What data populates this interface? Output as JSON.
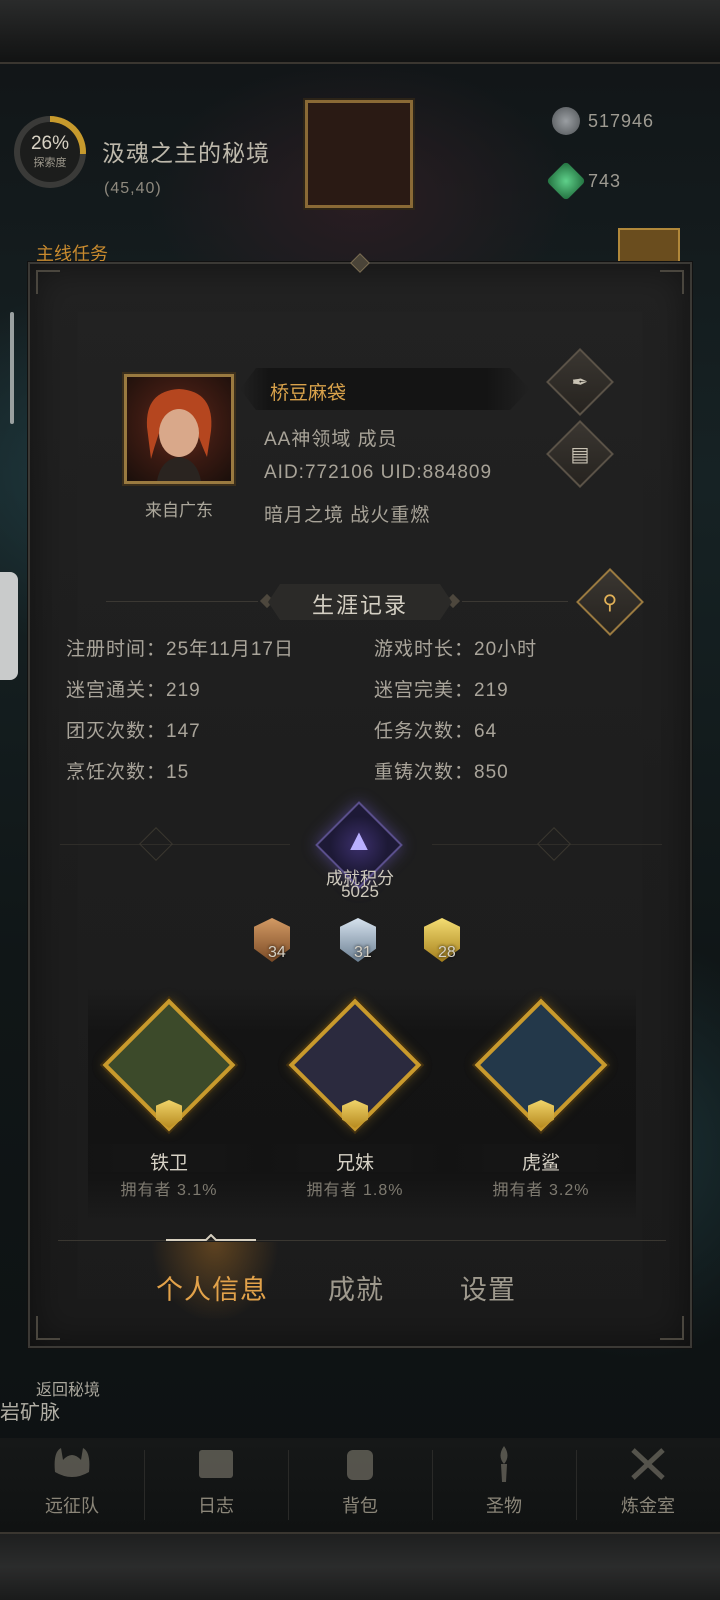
{
  "hud": {
    "explore_percent": "26%",
    "explore_label": "探索度",
    "realm_title": "汲魂之主的秘境",
    "realm_coord": "(45,40)",
    "silver_amount": "517946",
    "gem_amount": "743",
    "task_label": "主线任务",
    "back_label": "返回秘境",
    "area_label": "岩矿脉"
  },
  "profile": {
    "name": "桥豆麻袋",
    "guild": "AA神领域  成员",
    "ids": "AID:772106 UID:884809",
    "server": "暗月之境  战火重燃",
    "origin": "来自广东",
    "edit_icon": "quill-icon",
    "copy_icon": "document-icon"
  },
  "career": {
    "title": "生涯记录",
    "search_icon": "magnifier-icon",
    "stats": [
      {
        "label": "注册时间：25年11月17日"
      },
      {
        "label": "游戏时长：20小时"
      },
      {
        "label": "迷宫通关：219"
      },
      {
        "label": "迷宫完美：219"
      },
      {
        "label": "团灭次数：147"
      },
      {
        "label": "任务次数：64"
      },
      {
        "label": "烹饪次数：15"
      },
      {
        "label": "重铸次数：850"
      }
    ]
  },
  "achievement": {
    "label": "成就积分",
    "score": "5025",
    "medals": [
      {
        "tier": "bronze",
        "count": "34",
        "color": "#b37a48"
      },
      {
        "tier": "silver",
        "count": "31",
        "color": "#9fb3c6"
      },
      {
        "tier": "gold",
        "count": "28",
        "color": "#e0c24a"
      }
    ]
  },
  "heroes": [
    {
      "name": "铁卫",
      "ownership": "拥有者 3.1%",
      "bg": "#3c4a2a"
    },
    {
      "name": "兄妹",
      "ownership": "拥有者 1.8%",
      "bg": "#2b2a3e"
    },
    {
      "name": "虎鲨",
      "ownership": "拥有者 3.2%",
      "bg": "#23384a"
    }
  ],
  "tabs": [
    {
      "label": "个人信息",
      "active": true
    },
    {
      "label": "成就",
      "active": false
    },
    {
      "label": "设置",
      "active": false
    }
  ],
  "bottom_nav": [
    {
      "label": "远征队",
      "icon": "viking-helmet-icon"
    },
    {
      "label": "日志",
      "icon": "scroll-icon"
    },
    {
      "label": "背包",
      "icon": "backpack-icon"
    },
    {
      "label": "圣物",
      "icon": "torch-icon"
    },
    {
      "label": "炼金室",
      "icon": "alchemy-icon"
    }
  ],
  "colors": {
    "accent_gold": "#d9a24b",
    "tab_active": "#e2a24a",
    "panel_bg": "#1f1f1f"
  }
}
